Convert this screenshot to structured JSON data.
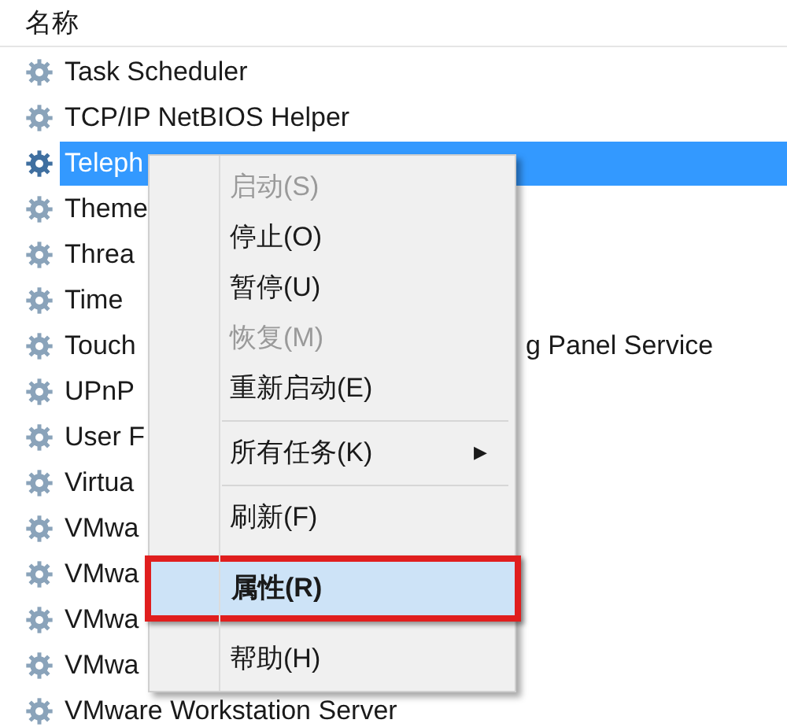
{
  "header": {
    "label": "名称"
  },
  "rows": [
    {
      "text": "Task Scheduler",
      "selected": false
    },
    {
      "text": "TCP/IP NetBIOS Helper",
      "selected": false
    },
    {
      "text": "Teleph",
      "selected": true
    },
    {
      "text": "Theme",
      "selected": false
    },
    {
      "text": "Threa",
      "selected": false
    },
    {
      "text": "Time",
      "selected": false
    },
    {
      "text": "Touch",
      "text_after": "g Panel Service",
      "selected": false
    },
    {
      "text": "UPnP",
      "selected": false
    },
    {
      "text": "User F",
      "selected": false
    },
    {
      "text": "Virtua",
      "selected": false
    },
    {
      "text": "VMwa",
      "selected": false
    },
    {
      "text": "VMwa",
      "selected": false
    },
    {
      "text": "VMwa",
      "selected": false
    },
    {
      "text": "VMwa",
      "selected": false
    },
    {
      "text": "VMware Workstation Server",
      "selected": false
    }
  ],
  "context_menu": {
    "items": [
      {
        "kind": "item",
        "label": "启动(S)",
        "disabled": true,
        "selected": false
      },
      {
        "kind": "item",
        "label": "停止(O)",
        "disabled": false,
        "selected": false
      },
      {
        "kind": "item",
        "label": "暂停(U)",
        "disabled": false,
        "selected": false
      },
      {
        "kind": "item",
        "label": "恢复(M)",
        "disabled": true,
        "selected": false
      },
      {
        "kind": "item",
        "label": "重新启动(E)",
        "disabled": false,
        "selected": false
      },
      {
        "kind": "separator"
      },
      {
        "kind": "submenu",
        "label": "所有任务(K)",
        "arrow": "▶",
        "disabled": false,
        "selected": false
      },
      {
        "kind": "separator"
      },
      {
        "kind": "item",
        "label": "刷新(F)",
        "disabled": false,
        "selected": false
      },
      {
        "kind": "item",
        "label": "属性(R)",
        "disabled": false,
        "selected": true,
        "annotated": true
      },
      {
        "kind": "item",
        "label": "帮助(H)",
        "disabled": false,
        "selected": false
      }
    ]
  }
}
